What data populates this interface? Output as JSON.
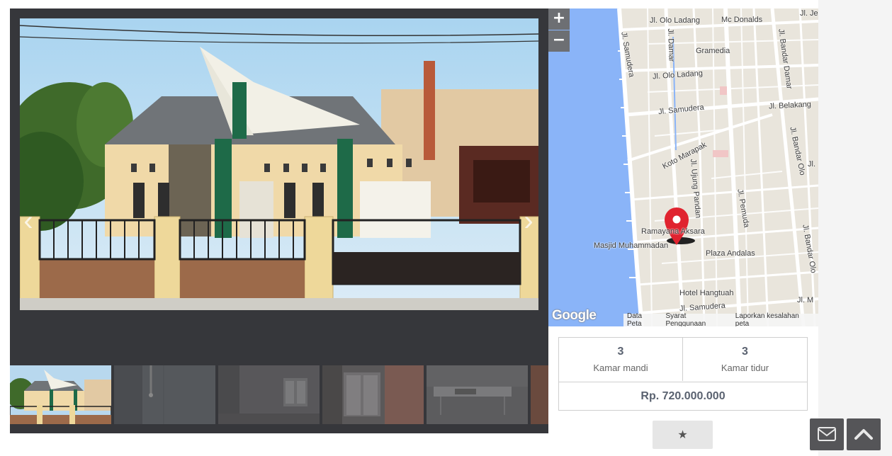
{
  "gallery": {
    "prev_glyph": "‹",
    "next_glyph": "›",
    "thumbnails": [
      {
        "name": "thumb-house-front",
        "active": true
      },
      {
        "name": "thumb-bathroom-shower"
      },
      {
        "name": "thumb-room-window"
      },
      {
        "name": "thumb-room-door"
      },
      {
        "name": "thumb-kitchen"
      }
    ]
  },
  "map": {
    "zoom_in": "+",
    "zoom_out": "−",
    "streets": {
      "olo_ladang_1": "Jl. Olo Ladang",
      "mc_donalds": "Mc Donalds",
      "je": "Jl. Je",
      "samudera_v": "Jl. Samudera",
      "damar": "Jl. Damar",
      "gramedia": "Gramedia",
      "bandar_damar": "Jl. Bandar Damar",
      "olo_ladang_2": "Jl. Olo Ladang",
      "samudera_h": "Jl. Samudera",
      "belakang": "Jl. Belakang",
      "koto_marapak": "Koto Marapak",
      "bandar_olo_1": "Jl. Bandar Olo",
      "ujung_pandan": "Jl. Ujung Pandan",
      "pemuda": "Jl. Pemuda",
      "jl_right": "Jl.",
      "ramayana": "Ramayana Aksara",
      "bandar_olo_2": "Jl. Bandar Olo",
      "masjid": "Masjid Muhammadan",
      "plaza": "Plaza Andalas",
      "hotel": "Hotel Hangtuah",
      "samudera_bottom": "Jl. Samudera",
      "jl_m": "Jl. M"
    },
    "google": "Google",
    "footer": {
      "data": "Data Peta",
      "terms": "Syarat Penggunaan",
      "report": "Laporkan kesalahan peta"
    },
    "colors": {
      "sea": "#8ab4f8",
      "land": "#e9e5dc",
      "road": "#ffffff",
      "marker": "#e0232f"
    }
  },
  "details": {
    "bathrooms": {
      "value": "3",
      "label": "Kamar mandi"
    },
    "bedrooms": {
      "value": "3",
      "label": "Kamar tidur"
    },
    "price": "Rp. 720.000.000"
  },
  "actions": {
    "favorite_icon": "star-icon",
    "favorite_glyph": "★",
    "mail_icon": "envelope-icon",
    "top_icon": "chevron-up-icon"
  }
}
